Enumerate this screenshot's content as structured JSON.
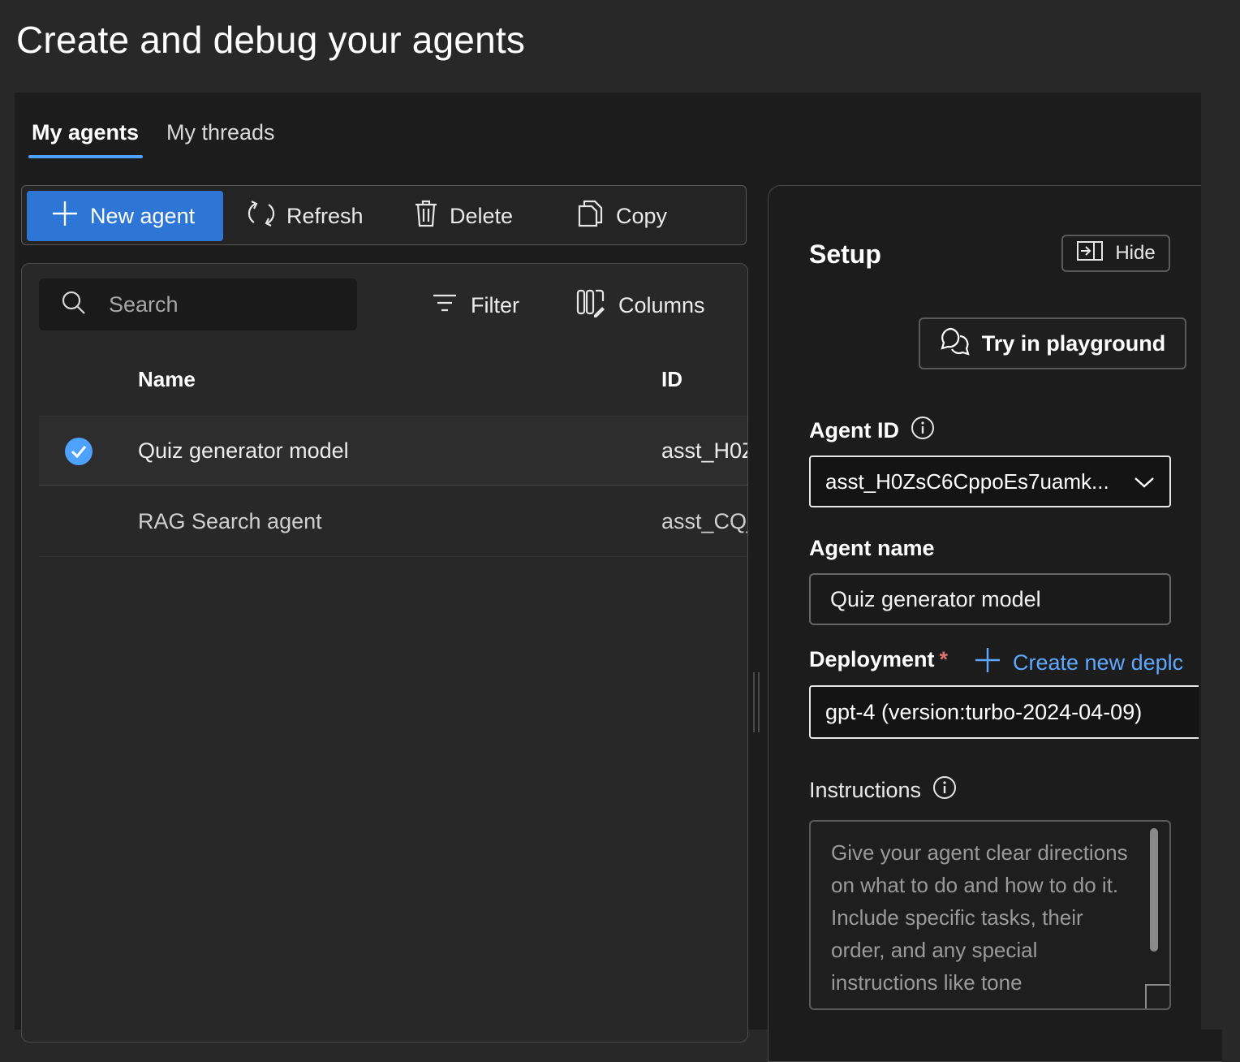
{
  "header": {
    "title": "Create and debug your agents"
  },
  "tabs": [
    {
      "label": "My agents",
      "active": true
    },
    {
      "label": "My threads",
      "active": false
    }
  ],
  "toolbar": {
    "new_agent": "New agent",
    "refresh": "Refresh",
    "delete": "Delete",
    "copy": "Copy"
  },
  "list": {
    "search_placeholder": "Search",
    "filter": "Filter",
    "columns": "Columns",
    "headers": {
      "name": "Name",
      "id": "ID"
    },
    "rows": [
      {
        "name": "Quiz generator model",
        "id": "asst_H0Z",
        "selected": true
      },
      {
        "name": "RAG Search agent",
        "id": "asst_CQj",
        "selected": false
      }
    ]
  },
  "setup": {
    "title": "Setup",
    "hide": "Hide",
    "try_playground": "Try in playground",
    "agent_id_label": "Agent ID",
    "agent_id_value": "asst_H0ZsC6CppoEs7uamk...",
    "agent_name_label": "Agent name",
    "agent_name_value": "Quiz generator model",
    "deployment_label": "Deployment",
    "required_mark": "*",
    "create_deployment": "Create new deplc",
    "deployment_value": "gpt-4 (version:turbo-2024-04-09)",
    "instructions_label": "Instructions",
    "instructions_placeholder": "Give your agent clear directions on what to do and how to do it. Include specific tasks, their order, and any special instructions like tone"
  },
  "colors": {
    "accent": "#2e76d6",
    "link": "#5ea7ff",
    "background": "#282828",
    "panel": "#1c1c1c"
  },
  "icons": [
    "plus-icon",
    "refresh-icon",
    "trash-icon",
    "copy-icon",
    "search-icon",
    "filter-icon",
    "columns-icon",
    "checkmark-circle-icon",
    "hide-panel-icon",
    "chat-icon",
    "info-icon",
    "chevron-down-icon"
  ]
}
